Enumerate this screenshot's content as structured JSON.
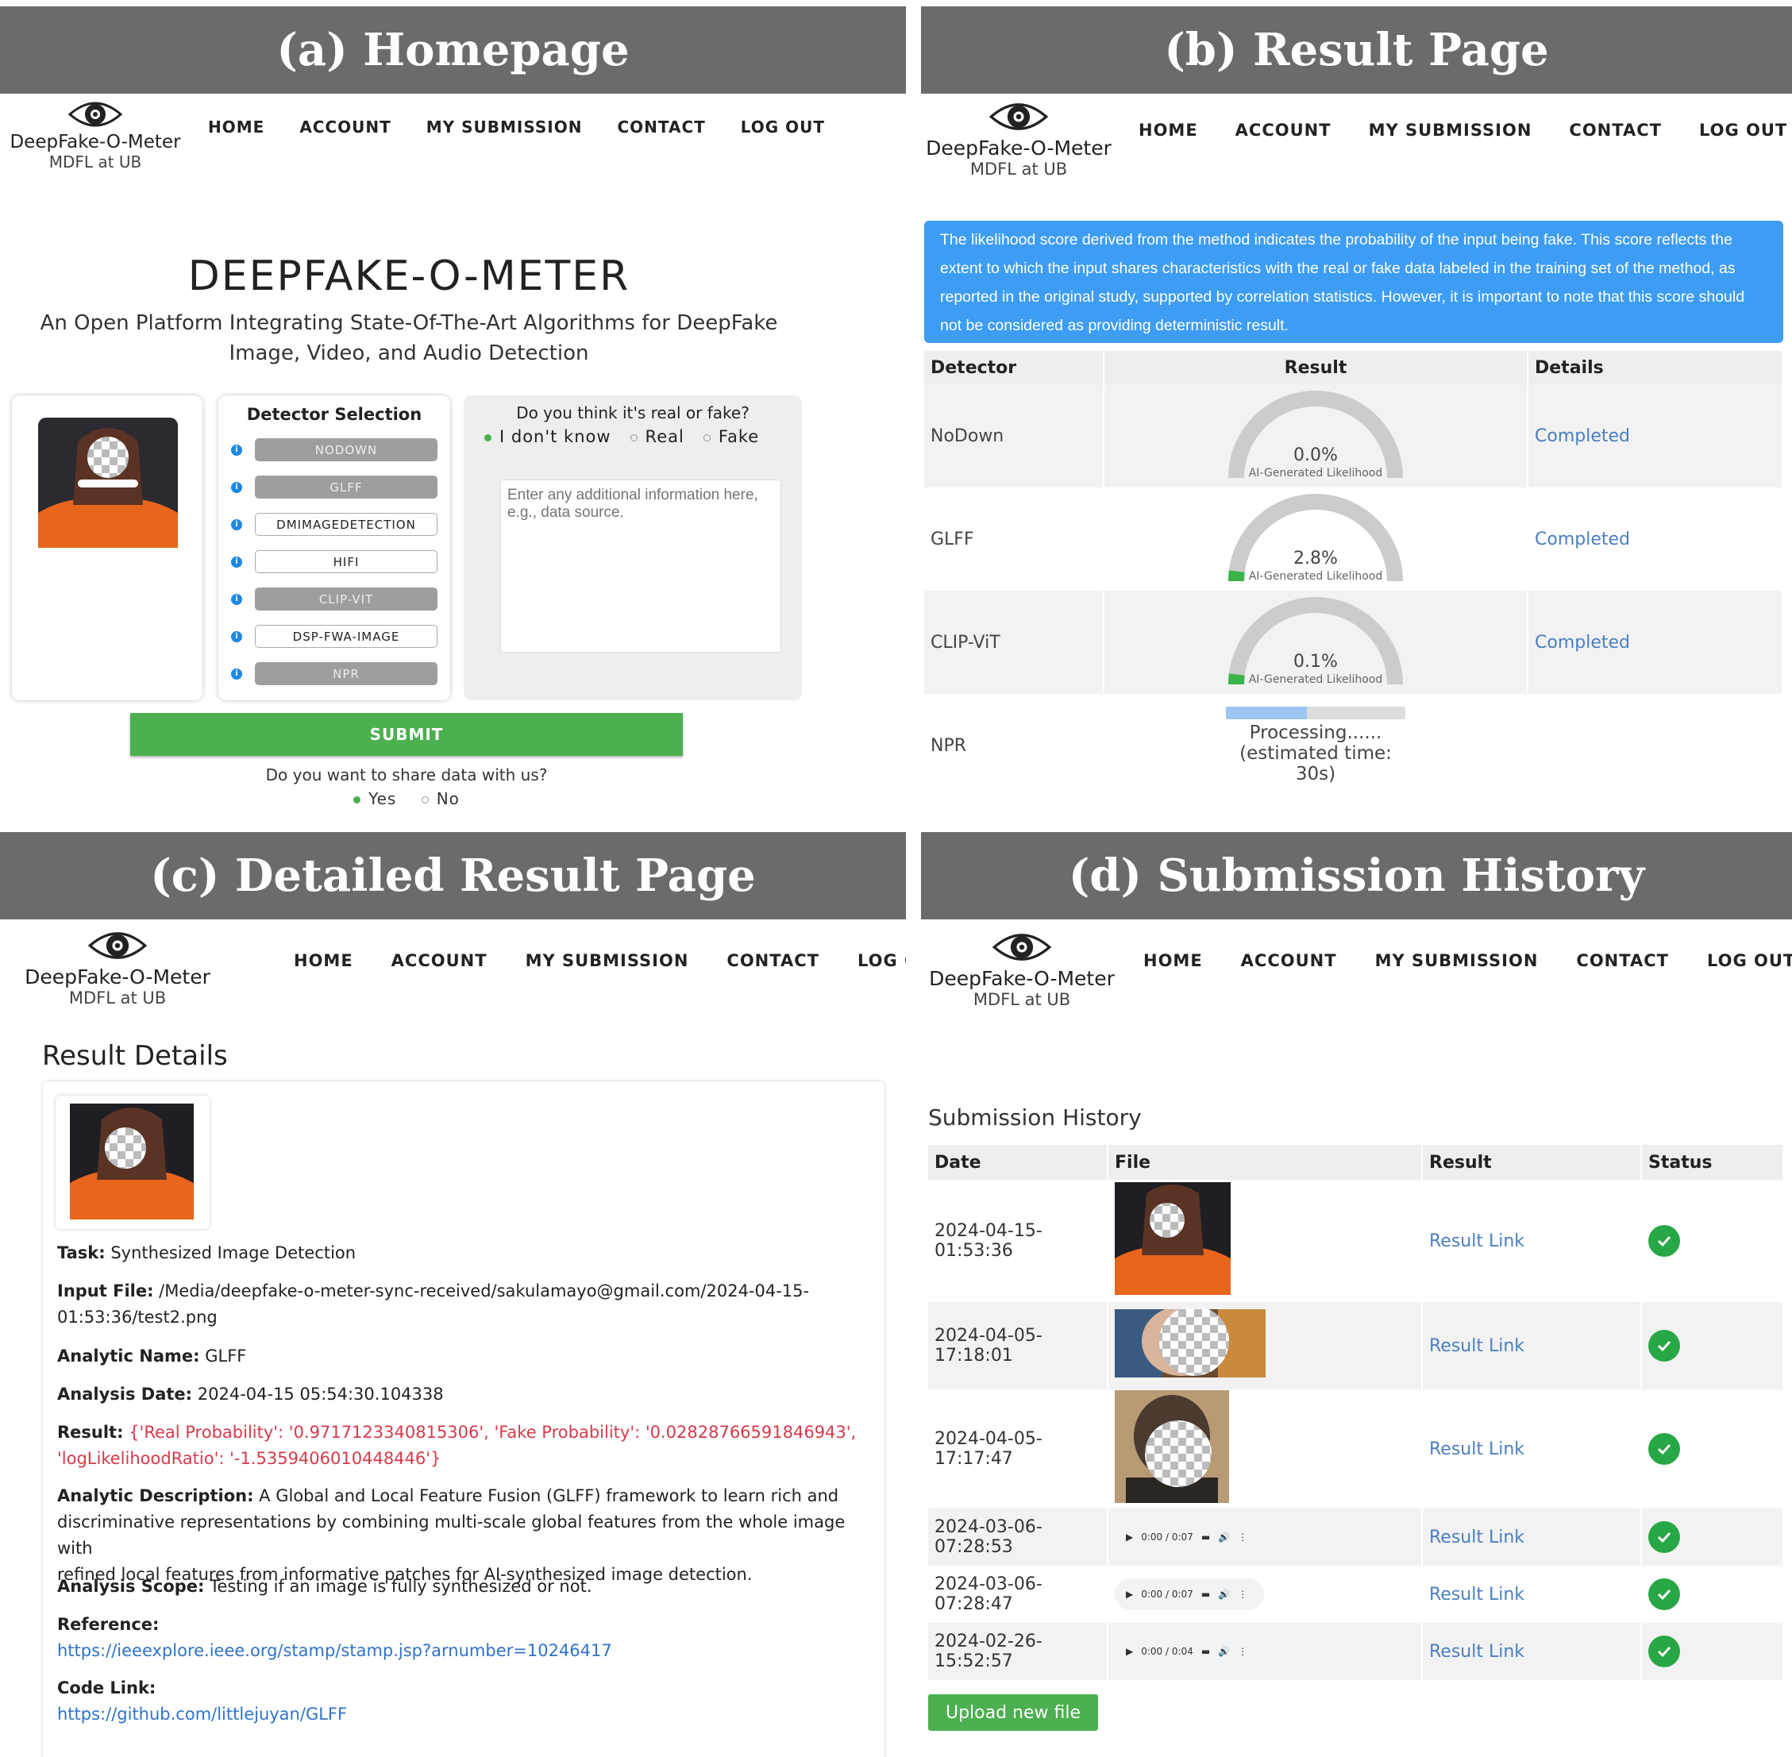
{
  "panels": {
    "a": {
      "banner": "(a) Homepage"
    },
    "b": {
      "banner": "(b) Result Page"
    },
    "c": {
      "banner": "(c) Detailed Result Page"
    },
    "d": {
      "banner": "(d) Submission History"
    }
  },
  "brand": {
    "name": "DeepFake-O-Meter",
    "sub": "MDFL at UB"
  },
  "nav": {
    "home": "HOME",
    "account": "ACCOUNT",
    "my_submission": "MY SUBMISSION",
    "contact": "CONTACT",
    "logout": "LOG OUT"
  },
  "homepage": {
    "title": "DEEPFAKE-O-METER",
    "subtitle_line1": "An Open Platform Integrating State-Of-The-Art Algorithms for DeepFake",
    "subtitle_line2": "Image, Video, and Audio Detection",
    "detector_selection_title": "Detector Selection",
    "detectors": [
      {
        "label": "NODOWN",
        "selected": true
      },
      {
        "label": "GLFF",
        "selected": true
      },
      {
        "label": "DMIMAGEDETECTION",
        "selected": false
      },
      {
        "label": "HIFI",
        "selected": false
      },
      {
        "label": "CLIP-VIT",
        "selected": true
      },
      {
        "label": "DSP-FWA-IMAGE",
        "selected": false
      },
      {
        "label": "NPR",
        "selected": true
      }
    ],
    "question": "Do you think it's real or fake?",
    "options": [
      "I don't know",
      "Real",
      "Fake"
    ],
    "selected_option": "I don't know",
    "textarea_placeholder": "Enter any additional information here, e.g., data source.",
    "submit_label": "SUBMIT",
    "share_question": "Do you want to share data with us?",
    "share_options": [
      "Yes",
      "No"
    ],
    "share_selected": "Yes"
  },
  "result_page": {
    "notice": "The likelihood score derived from the method indicates the probability of the input being fake. This score reflects the extent to which the input shares characteristics with the real or fake data labeled in the training set of the method, as reported in the original study, supported by correlation statistics. However, it is important to note that this score should not be considered as providing deterministic result.",
    "headers": [
      "Detector",
      "Result",
      "Details"
    ],
    "gauge_caption": "AI-Generated Likelihood",
    "rows": [
      {
        "detector": "NoDown",
        "value": "0.0%",
        "fraction": 0.0,
        "details": "Completed"
      },
      {
        "detector": "GLFF",
        "value": "2.8%",
        "fraction": 0.028,
        "details": "Completed"
      },
      {
        "detector": "CLIP-ViT",
        "value": "0.1%",
        "fraction": 0.001,
        "details": "Completed"
      }
    ],
    "processing_row": {
      "detector": "NPR",
      "progress": 0.45,
      "text1": "Processing......",
      "text2": "(estimated time:",
      "text3": "30s)"
    }
  },
  "detail_page": {
    "title": "Result Details",
    "task_label": "Task:",
    "task": "Synthesized Image Detection",
    "input_label": "Input File:",
    "input_line1": "/Media/deepfake-o-meter-sync-received/sakulamayo@gmail.com/2024-04-15-",
    "input_line2": "01:53:36/test2.png",
    "analytic_name_label": "Analytic Name:",
    "analytic_name": "GLFF",
    "analysis_date_label": "Analysis Date:",
    "analysis_date": "2024-04-15 05:54:30.104338",
    "result_label": "Result:",
    "result_line1": "{'Real Probability': '0.9717123340815306', 'Fake Probability': '0.02828766591846943',",
    "result_line2": "'logLikelihoodRatio': '-1.5359406010448446'}",
    "desc_label": "Analytic Description:",
    "desc_line1": "A Global and Local Feature Fusion (GLFF) framework to learn rich and",
    "desc_line2": "discriminative representations by combining multi-scale global features from the whole image with",
    "desc_line3": "refined local features from informative patches for AI-synthesized image detection.",
    "scope_label": "Analysis Scope:",
    "scope": "Testing if an image is fully synthesized or not.",
    "reference_label": "Reference:",
    "reference": "https://ieeexplore.ieee.org/stamp/stamp.jsp?arnumber=10246417",
    "code_label": "Code Link:",
    "code": "https://github.com/littlejuyan/GLFF"
  },
  "history": {
    "title": "Submission History",
    "headers": [
      "Date",
      "File",
      "Result",
      "Status"
    ],
    "rows": [
      {
        "date1": "2024-04-15-",
        "date2": "01:53:36",
        "file": "image",
        "result": "Result Link"
      },
      {
        "date1": "2024-04-05-",
        "date2": "17:18:01",
        "file": "image",
        "result": "Result Link"
      },
      {
        "date1": "2024-04-05-",
        "date2": "17:17:47",
        "file": "image",
        "result": "Result Link"
      },
      {
        "date1": "2024-03-06-",
        "date2": "07:28:53",
        "file": "audio",
        "audio_time": "0:00 / 0:07",
        "result": "Result Link"
      },
      {
        "date1": "2024-03-06-",
        "date2": "07:28:47",
        "file": "audio",
        "audio_time": "0:00 / 0:07",
        "result": "Result Link"
      },
      {
        "date1": "2024-02-26-",
        "date2": "15:52:57",
        "file": "audio",
        "audio_time": "0:00 / 0:04",
        "result": "Result Link"
      }
    ],
    "upload_label": "Upload new file"
  },
  "colors": {
    "banner": "#6b6b6b",
    "green": "#4caf50",
    "blue_notice": "#3d9df5",
    "link": "#4a7fc1",
    "red": "#d63a4a"
  }
}
